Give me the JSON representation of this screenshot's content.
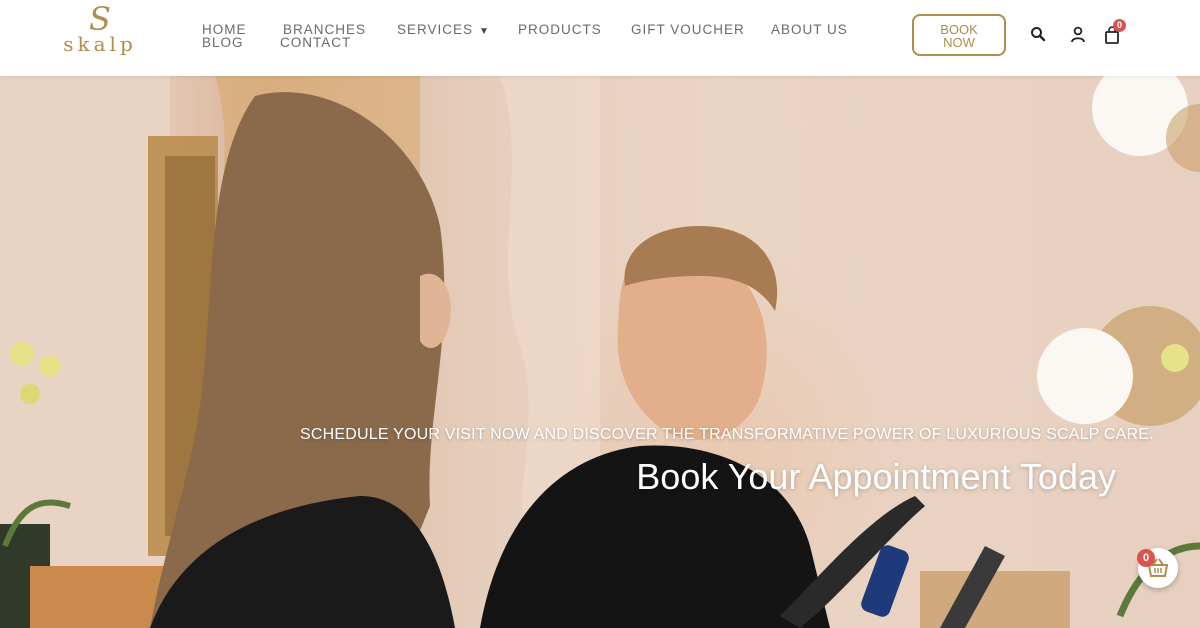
{
  "brand": {
    "logo_mark": "S",
    "logo_text": "skalp",
    "gold_color": "#b08d4a"
  },
  "nav": {
    "home": "HOME",
    "blog": "BLOG",
    "branches": "BRANCHES",
    "contact": "CONTACT",
    "services": "SERVICES",
    "products": "PRODUCTS",
    "gift_voucher": "GIFT VOUCHER",
    "about_us": "ABOUT US",
    "book_now_line1": "BOOK",
    "book_now_line2": "NOW"
  },
  "header_icons": {
    "search": "search-icon",
    "account": "user-icon",
    "cart": "shopping-bag-icon",
    "cart_count": "0"
  },
  "hero": {
    "subtitle": "SCHEDULE YOUR VISIT NOW AND DISCOVER THE TRANSFORMATIVE POWER OF LUXURIOUS SCALP CARE.",
    "title": "Book Your Appointment Today"
  },
  "floating_cart": {
    "icon": "basket-icon",
    "count": "0",
    "badge_color": "#d9534f"
  }
}
